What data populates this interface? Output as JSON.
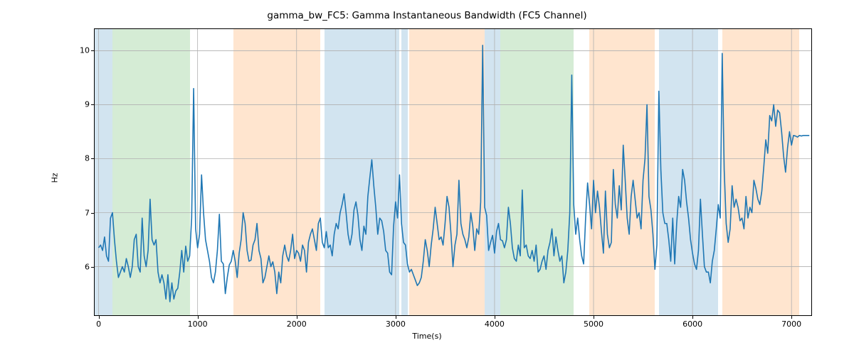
{
  "chart_data": {
    "type": "line",
    "title": "gamma_bw_FC5: Gamma Instantaneous Bandwidth (FC5 Channel)",
    "xlabel": "Time(s)",
    "ylabel": "Hz",
    "xlim": [
      -40,
      7200
    ],
    "ylim": [
      5.1,
      10.4
    ],
    "xticks": [
      0,
      1000,
      2000,
      3000,
      4000,
      5000,
      6000,
      7000
    ],
    "yticks": [
      6,
      7,
      8,
      9,
      10
    ],
    "regions": [
      {
        "x0": -40,
        "x1": 140,
        "color": "blue"
      },
      {
        "x0": 140,
        "x1": 920,
        "color": "green"
      },
      {
        "x0": 1360,
        "x1": 2240,
        "color": "orange"
      },
      {
        "x0": 2280,
        "x1": 3040,
        "color": "blue"
      },
      {
        "x0": 3060,
        "x1": 3120,
        "color": "blue"
      },
      {
        "x0": 3140,
        "x1": 3900,
        "color": "orange"
      },
      {
        "x0": 3900,
        "x1": 4060,
        "color": "blue"
      },
      {
        "x0": 4060,
        "x1": 4800,
        "color": "green"
      },
      {
        "x0": 4960,
        "x1": 5620,
        "color": "orange"
      },
      {
        "x0": 5660,
        "x1": 6260,
        "color": "blue"
      },
      {
        "x0": 6300,
        "x1": 7080,
        "color": "orange"
      }
    ],
    "series": [
      {
        "name": "gamma_bw_FC5",
        "x_step": 20,
        "x_start": 0,
        "values": [
          6.35,
          6.4,
          6.3,
          6.55,
          6.2,
          6.1,
          6.9,
          7.0,
          6.5,
          6.1,
          5.8,
          5.9,
          6.0,
          5.9,
          6.15,
          6.0,
          5.8,
          6.0,
          6.5,
          6.6,
          6.0,
          5.9,
          6.9,
          6.2,
          6.0,
          6.3,
          7.25,
          6.5,
          6.4,
          6.5,
          5.9,
          5.7,
          5.85,
          5.7,
          5.4,
          5.85,
          5.35,
          5.7,
          5.4,
          5.55,
          5.6,
          5.9,
          6.3,
          5.9,
          6.38,
          6.1,
          6.2,
          6.9,
          9.3,
          6.7,
          6.35,
          6.6,
          7.7,
          7.0,
          6.5,
          6.3,
          6.1,
          5.8,
          5.7,
          5.9,
          6.3,
          6.97,
          6.1,
          6.05,
          5.5,
          5.8,
          6.03,
          6.1,
          6.3,
          6.1,
          5.8,
          6.25,
          6.5,
          7.0,
          6.8,
          6.3,
          6.1,
          6.12,
          6.4,
          6.5,
          6.8,
          6.3,
          6.15,
          5.7,
          5.8,
          6.0,
          6.2,
          6.0,
          6.09,
          5.9,
          5.5,
          5.9,
          5.7,
          6.2,
          6.4,
          6.2,
          6.1,
          6.3,
          6.6,
          6.15,
          6.3,
          6.25,
          6.1,
          6.4,
          6.3,
          5.9,
          6.45,
          6.6,
          6.7,
          6.5,
          6.3,
          6.8,
          6.9,
          6.45,
          6.35,
          6.65,
          6.35,
          6.4,
          6.2,
          6.6,
          6.8,
          6.7,
          7.0,
          7.15,
          7.35,
          7.0,
          6.6,
          6.4,
          6.6,
          7.05,
          7.2,
          6.95,
          6.5,
          6.3,
          6.75,
          6.6,
          7.3,
          7.65,
          7.98,
          7.5,
          7.1,
          6.6,
          6.9,
          6.85,
          6.65,
          6.3,
          6.25,
          5.9,
          5.85,
          6.75,
          7.2,
          6.9,
          7.7,
          6.8,
          6.45,
          6.4,
          6.05,
          5.9,
          5.95,
          5.85,
          5.75,
          5.65,
          5.7,
          5.8,
          6.1,
          6.5,
          6.3,
          6.0,
          6.4,
          6.7,
          7.1,
          6.8,
          6.5,
          6.55,
          6.4,
          6.8,
          7.3,
          7.1,
          6.6,
          6.0,
          6.4,
          6.6,
          7.6,
          6.8,
          6.6,
          6.5,
          6.35,
          6.55,
          7.0,
          6.75,
          6.3,
          6.7,
          6.6,
          7.2,
          10.1,
          7.1,
          6.95,
          6.3,
          6.45,
          6.58,
          6.25,
          6.65,
          6.8,
          6.5,
          6.48,
          6.35,
          6.5,
          7.1,
          6.8,
          6.35,
          6.15,
          6.1,
          6.4,
          6.2,
          7.42,
          6.35,
          6.4,
          6.2,
          6.15,
          6.3,
          6.1,
          6.4,
          5.9,
          5.95,
          6.1,
          6.2,
          5.95,
          6.3,
          6.45,
          6.7,
          6.2,
          6.55,
          6.3,
          6.1,
          6.2,
          5.7,
          5.9,
          6.3,
          7.0,
          9.55,
          7.15,
          6.6,
          6.9,
          6.5,
          6.2,
          6.05,
          6.9,
          7.55,
          7.15,
          6.7,
          7.6,
          7.0,
          7.4,
          7.1,
          6.65,
          6.25,
          7.4,
          6.6,
          6.35,
          6.45,
          7.8,
          7.15,
          6.9,
          7.5,
          7.05,
          8.25,
          7.6,
          6.9,
          6.6,
          7.3,
          7.6,
          7.25,
          6.9,
          7.0,
          6.7,
          7.6,
          8.0,
          9.0,
          7.3,
          7.05,
          6.6,
          5.95,
          6.4,
          9.25,
          7.8,
          7.0,
          6.8,
          6.8,
          6.5,
          6.1,
          6.9,
          6.05,
          6.8,
          7.3,
          7.1,
          7.8,
          7.6,
          7.2,
          6.9,
          6.5,
          6.25,
          6.05,
          5.95,
          6.3,
          7.25,
          6.6,
          6.0,
          5.9,
          5.9,
          5.7,
          6.1,
          6.3,
          6.7,
          7.15,
          6.9,
          9.95,
          7.8,
          6.8,
          6.45,
          6.7,
          7.5,
          7.1,
          7.25,
          7.1,
          6.85,
          6.9,
          6.7,
          7.3,
          6.9,
          7.1,
          7.0,
          7.6,
          7.45,
          7.25,
          7.15,
          7.4,
          7.85,
          8.35,
          8.1,
          8.8,
          8.7,
          9.0,
          8.6,
          8.9,
          8.85,
          8.5,
          8.05,
          7.75,
          8.2,
          8.5,
          8.25,
          8.43,
          8.42,
          8.4,
          8.43,
          8.42,
          8.43,
          8.43,
          8.43,
          8.43
        ]
      }
    ]
  }
}
